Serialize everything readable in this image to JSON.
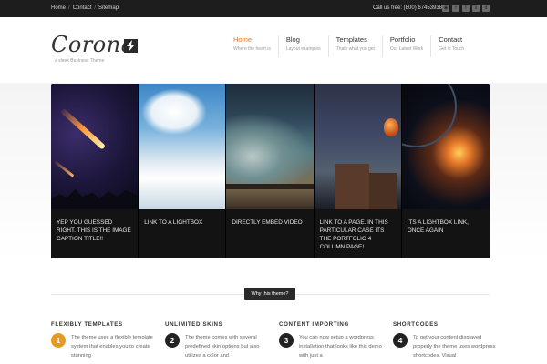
{
  "topbar": {
    "links": [
      "Home",
      "Contact",
      "Sitemap"
    ],
    "separators": [
      "/",
      "/"
    ],
    "call_text": "Call us free: (800) 67453938",
    "social_icons": [
      "rss-icon",
      "facebook-icon",
      "twitter-icon",
      "stumbleupon-icon",
      "delicious-icon"
    ]
  },
  "logo": {
    "word": "Corona",
    "tagline": "a sleek Business Theme"
  },
  "nav": [
    {
      "label": "Home",
      "sub": "Where the heart is",
      "active": true
    },
    {
      "label": "Blog",
      "sub": "Layout examples",
      "active": false
    },
    {
      "label": "Templates",
      "sub": "Thats what you get",
      "active": false
    },
    {
      "label": "Portfolio",
      "sub": "Our Latest Work",
      "active": false
    },
    {
      "label": "Contact",
      "sub": "Get in Touch",
      "active": false
    }
  ],
  "slider": {
    "panels": [
      {
        "caption": "YEP YOU GUESSED RIGHT. THIS IS THE IMAGE CAPTION TITLE!!"
      },
      {
        "caption": "LINK TO A LIGHTBOX"
      },
      {
        "caption": "DIRECTLY EMBED VIDEO"
      },
      {
        "caption": "LINK TO A PAGE. IN THIS PARTICULAR CASE ITS THE PORTFOLIO 4 COLUMN PAGE!"
      },
      {
        "caption": "ITS A LIGHTBOX LINK, ONCE AGAIN"
      }
    ]
  },
  "why_button": "Why this theme?",
  "features": [
    {
      "title": "FLEXIBLY TEMPLATES",
      "number": "1",
      "text": "The theme uses a flexible template system that enables you to create stunning"
    },
    {
      "title": "UNLIMITED SKINS",
      "number": "2",
      "text": "The theme comes with several predefined skin options but also utilizes a color and"
    },
    {
      "title": "CONTENT IMPORTING",
      "number": "3",
      "text": "You can now setup a wordpress installation that looks like this demo with just a"
    },
    {
      "title": "SHORTCODES",
      "number": "4",
      "text": "To get your content displayed properly the theme uses wordpress shortcodes. Visual"
    }
  ],
  "colors": {
    "accent": "#e07a34",
    "topbar_bg": "#1d1d1d",
    "number_badge_first": "#e69a1f"
  }
}
